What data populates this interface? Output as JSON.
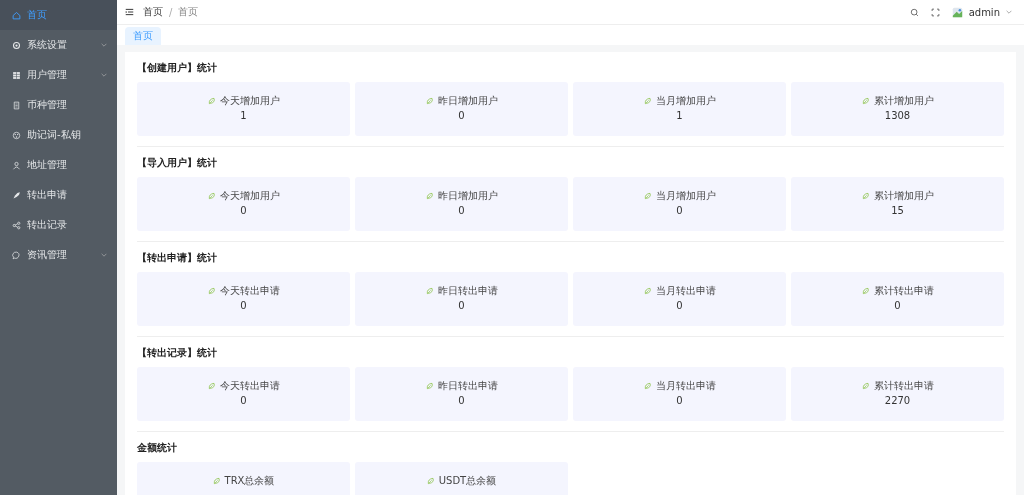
{
  "sidebar": {
    "items": [
      {
        "label": "首页",
        "selected": true,
        "expandable": false
      },
      {
        "label": "系统设置",
        "selected": false,
        "expandable": true
      },
      {
        "label": "用户管理",
        "selected": false,
        "expandable": true
      },
      {
        "label": "币种管理",
        "selected": false,
        "expandable": false
      },
      {
        "label": "助记词-私钥",
        "selected": false,
        "expandable": false
      },
      {
        "label": "地址管理",
        "selected": false,
        "expandable": false
      },
      {
        "label": "转出申请",
        "selected": false,
        "expandable": false
      },
      {
        "label": "转出记录",
        "selected": false,
        "expandable": false
      },
      {
        "label": "资讯管理",
        "selected": false,
        "expandable": true
      }
    ]
  },
  "header": {
    "breadcrumb": [
      "首页",
      "首页"
    ],
    "separator": "/",
    "user": "admin"
  },
  "tabs": [
    {
      "label": "首页",
      "selected": true
    }
  ],
  "sections": [
    {
      "title": "【创建用户】统计",
      "cards": [
        {
          "label": "今天增加用户",
          "value": "1"
        },
        {
          "label": "昨日增加用户",
          "value": "0"
        },
        {
          "label": "当月增加用户",
          "value": "1"
        },
        {
          "label": "累计增加用户",
          "value": "1308"
        }
      ]
    },
    {
      "title": "【导入用户】统计",
      "cards": [
        {
          "label": "今天增加用户",
          "value": "0"
        },
        {
          "label": "昨日增加用户",
          "value": "0"
        },
        {
          "label": "当月增加用户",
          "value": "0"
        },
        {
          "label": "累计增加用户",
          "value": "15"
        }
      ]
    },
    {
      "title": "【转出申请】统计",
      "cards": [
        {
          "label": "今天转出申请",
          "value": "0"
        },
        {
          "label": "昨日转出申请",
          "value": "0"
        },
        {
          "label": "当月转出申请",
          "value": "0"
        },
        {
          "label": "累计转出申请",
          "value": "0"
        }
      ]
    },
    {
      "title": "【转出记录】统计",
      "cards": [
        {
          "label": "今天转出申请",
          "value": "0"
        },
        {
          "label": "昨日转出申请",
          "value": "0"
        },
        {
          "label": "当月转出申请",
          "value": "0"
        },
        {
          "label": "累计转出申请",
          "value": "2270"
        }
      ]
    },
    {
      "title": "金额统计",
      "cards": [
        {
          "label": "TRX总余额"
        },
        {
          "label": "USDT总余额"
        }
      ]
    }
  ]
}
